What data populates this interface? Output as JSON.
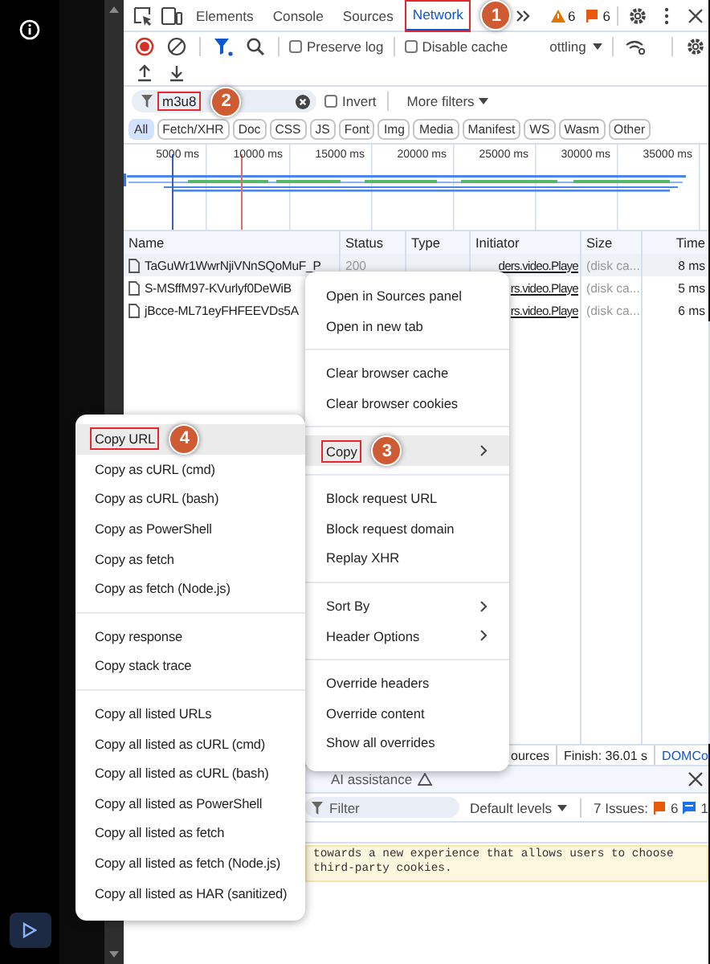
{
  "tabs": [
    {
      "label": "Elements",
      "selected": false,
      "outlined": false
    },
    {
      "label": "Console",
      "selected": false,
      "outlined": false
    },
    {
      "label": "Sources",
      "selected": false,
      "outlined": false
    },
    {
      "label": "Network",
      "selected": true,
      "outlined": true,
      "callout": "1"
    }
  ],
  "counters": [
    {
      "kind": "warning",
      "count": "6"
    },
    {
      "kind": "error",
      "count": "6"
    }
  ],
  "toolbar": {
    "checkboxes": [
      {
        "label": "Preserve log",
        "checked": false
      },
      {
        "label": "Disable cache",
        "checked": false
      }
    ],
    "throttling": "ottling"
  },
  "filter": {
    "value": "m3u8",
    "outlined": true,
    "callout": "2",
    "invert": {
      "label": "Invert",
      "checked": false
    },
    "more_filters": "More filters"
  },
  "type_filters": [
    {
      "label": "All",
      "selected": true
    },
    {
      "label": "Fetch/XHR",
      "selected": false
    },
    {
      "label": "Doc",
      "selected": false
    },
    {
      "label": "CSS",
      "selected": false
    },
    {
      "label": "JS",
      "selected": false
    },
    {
      "label": "Font",
      "selected": false
    },
    {
      "label": "Img",
      "selected": false
    },
    {
      "label": "Media",
      "selected": false
    },
    {
      "label": "Manifest",
      "selected": false
    },
    {
      "label": "WS",
      "selected": false
    },
    {
      "label": "Wasm",
      "selected": false
    },
    {
      "label": "Other",
      "selected": false
    }
  ],
  "timeline": {
    "ticks": [
      "5000 ms",
      "10000 ms",
      "15000 ms",
      "20000 ms",
      "25000 ms",
      "30000 ms",
      "35000 ms"
    ]
  },
  "table": {
    "columns": [
      "Name",
      "Status",
      "Type",
      "Initiator",
      "Size",
      "Time"
    ],
    "rows": [
      {
        "name": "TaGuWr1WwrNjiVNnSQoMuF_P",
        "status": "200",
        "initiator": "ders.video.Playe",
        "size": "(disk ca...",
        "time": "8 ms",
        "selected": true
      },
      {
        "name": "S-MSffM97-KVurlyf0DeWiB",
        "initiator": "rs.video.Playe",
        "size": "(disk ca...",
        "time": "5 ms",
        "selected": false
      },
      {
        "name": "jBcce-ML71eyFHFEEVDs5A",
        "initiator": "rs.video.Playe",
        "size": "(disk ca...",
        "time": "6 ms",
        "selected": false
      }
    ]
  },
  "status_bar": [
    "ources",
    "Finish: 36.01 s",
    "DOMCo"
  ],
  "drawer": {
    "tab": "AI assistance",
    "filter_placeholder": "Filter",
    "levels": "Default levels",
    "issues_label": "7 Issues:",
    "issue_counts": [
      {
        "kind": "error",
        "count": "6"
      },
      {
        "kind": "info",
        "count": "1"
      }
    ],
    "message": "towards a new experience that allows users to choose third-party cookies."
  },
  "context_menu": {
    "groups": [
      [
        {
          "label": "Open in Sources panel",
          "submenu": false,
          "highlighted": false,
          "outlined": false
        },
        {
          "label": "Open in new tab",
          "submenu": false,
          "highlighted": false,
          "outlined": false
        }
      ],
      [
        {
          "label": "Clear browser cache",
          "submenu": false,
          "highlighted": false,
          "outlined": false
        },
        {
          "label": "Clear browser cookies",
          "submenu": false,
          "highlighted": false,
          "outlined": false
        }
      ],
      [
        {
          "label": "Copy",
          "submenu": true,
          "highlighted": true,
          "outlined": true,
          "callout": "3"
        }
      ],
      [
        {
          "label": "Block request URL",
          "submenu": false,
          "highlighted": false,
          "outlined": false
        },
        {
          "label": "Block request domain",
          "submenu": false,
          "highlighted": false,
          "outlined": false
        },
        {
          "label": "Replay XHR",
          "submenu": false,
          "highlighted": false,
          "outlined": false
        }
      ],
      [
        {
          "label": "Sort By",
          "submenu": true,
          "highlighted": false,
          "outlined": false
        },
        {
          "label": "Header Options",
          "submenu": true,
          "highlighted": false,
          "outlined": false
        }
      ],
      [
        {
          "label": "Override headers",
          "submenu": false,
          "highlighted": false,
          "outlined": false
        },
        {
          "label": "Override content",
          "submenu": false,
          "highlighted": false,
          "outlined": false
        },
        {
          "label": "Show all overrides",
          "submenu": false,
          "highlighted": false,
          "outlined": false
        }
      ]
    ]
  },
  "copy_submenu": {
    "groups": [
      [
        {
          "label": "Copy URL",
          "submenu": false,
          "highlighted": true,
          "outlined": true,
          "callout": "4"
        },
        {
          "label": "Copy as cURL (cmd)",
          "submenu": false,
          "highlighted": false,
          "outlined": false
        },
        {
          "label": "Copy as cURL (bash)",
          "submenu": false,
          "highlighted": false,
          "outlined": false
        },
        {
          "label": "Copy as PowerShell",
          "submenu": false,
          "highlighted": false,
          "outlined": false
        },
        {
          "label": "Copy as fetch",
          "submenu": false,
          "highlighted": false,
          "outlined": false
        },
        {
          "label": "Copy as fetch (Node.js)",
          "submenu": false,
          "highlighted": false,
          "outlined": false
        }
      ],
      [
        {
          "label": "Copy response",
          "submenu": false,
          "highlighted": false,
          "outlined": false
        },
        {
          "label": "Copy stack trace",
          "submenu": false,
          "highlighted": false,
          "outlined": false
        }
      ],
      [
        {
          "label": "Copy all listed URLs",
          "submenu": false,
          "highlighted": false,
          "outlined": false
        },
        {
          "label": "Copy all listed as cURL (cmd)",
          "submenu": false,
          "highlighted": false,
          "outlined": false
        },
        {
          "label": "Copy all listed as cURL (bash)",
          "submenu": false,
          "highlighted": false,
          "outlined": false
        },
        {
          "label": "Copy all listed as PowerShell",
          "submenu": false,
          "highlighted": false,
          "outlined": false
        },
        {
          "label": "Copy all listed as fetch",
          "submenu": false,
          "highlighted": false,
          "outlined": false
        },
        {
          "label": "Copy all listed as fetch (Node.js)",
          "submenu": false,
          "highlighted": false,
          "outlined": false
        },
        {
          "label": "Copy all listed as HAR (sanitized)",
          "submenu": false,
          "highlighted": false,
          "outlined": false
        }
      ]
    ]
  }
}
